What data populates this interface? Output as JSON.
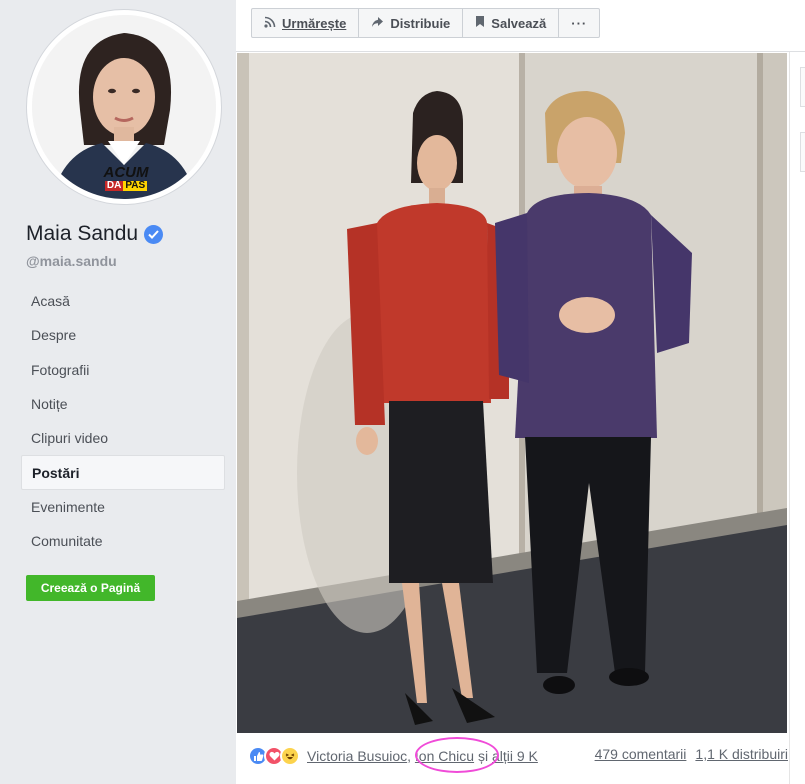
{
  "profile": {
    "name": "Maia Sandu",
    "handle": "@maia.sandu",
    "avatar_badge_line1": "ACUM",
    "avatar_badge_da": "DA",
    "avatar_badge_pas": "PAS"
  },
  "nav": {
    "items": [
      {
        "label": "Acasă"
      },
      {
        "label": "Despre"
      },
      {
        "label": "Fotografii"
      },
      {
        "label": "Notițe"
      },
      {
        "label": "Clipuri video"
      },
      {
        "label": "Postări"
      },
      {
        "label": "Evenimente"
      },
      {
        "label": "Comunitate"
      }
    ],
    "active_index": 5,
    "create_page_label": "Creează o Pagină"
  },
  "toolbar": {
    "follow_label": "Urmărește",
    "share_label": "Distribuie",
    "save_label": "Salvează",
    "more_label": "···"
  },
  "post": {
    "reaction_name_1": "Victoria Busuioc",
    "reaction_name_2": "Ion Chicu",
    "reaction_joiner": "și",
    "reaction_others": "alții 9 K",
    "comments": "479 comentarii",
    "shares": "1,1 K distribuiri"
  },
  "colors": {
    "brand_blue": "#4a8af4",
    "create_green": "#42b72a",
    "annotation_circle": "#f04bd8",
    "red_jacket": "#c0392b",
    "purple_jacket": "#4a3a6b"
  },
  "icons": [
    "rss-icon",
    "share-arrow-icon",
    "bookmark-icon",
    "verified-icon",
    "like-reaction-icon",
    "love-reaction-icon",
    "haha-reaction-icon"
  ]
}
